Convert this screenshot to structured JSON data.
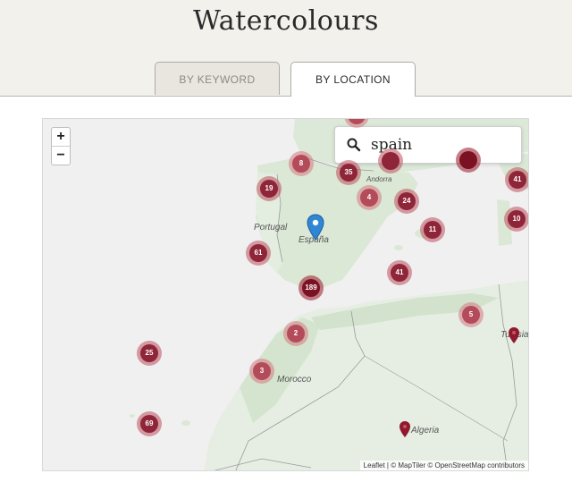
{
  "page": {
    "title": "Watercolours"
  },
  "tabs": [
    {
      "label": "BY KEYWORD",
      "active": false
    },
    {
      "label": "BY LOCATION",
      "active": true
    }
  ],
  "map": {
    "zoom_in": "+",
    "zoom_out": "−",
    "search": {
      "value": "spain",
      "icon": "search-icon"
    },
    "labels": {
      "portugal": "Portugal",
      "espana": "España",
      "andorra": "Andorra",
      "morocco": "Morocco",
      "algeria": "Algeria",
      "tunisia": "Tunisia"
    },
    "clusters": [
      "8",
      "35",
      "41",
      "19",
      "4",
      "24",
      "10",
      "11",
      "61",
      "41",
      "189",
      "5",
      "2",
      "25",
      "3",
      "69"
    ],
    "attribution": "Leaflet | © MapTiler © OpenStreetMap contributors",
    "colors": {
      "marker": "#8f2538",
      "selected_pin": "#2f86d4"
    }
  }
}
